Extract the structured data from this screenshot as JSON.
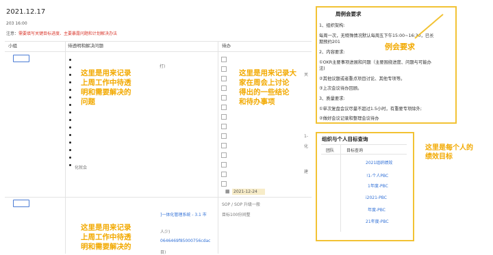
{
  "header": {
    "date": "2021.12.17",
    "time": "203 16:00",
    "note_prefix": "注意：",
    "note_red": "需要填写关键目标进度、主要暴露问题和计划解决办法"
  },
  "table": {
    "col_group": "小组",
    "col_issues": "待透明和解决问题",
    "col_todo": "待办"
  },
  "annotations": {
    "issues_1": "这里是用来记录\n上周工作中待透\n明和需要解决的\n问题",
    "todo": "这里是用来记录大\n家在周会上讨论\n得出的一些结论\n和待办事项",
    "issues_2": "这里是用来记录\n上周工作中待透\n明和需要解决的",
    "meeting_req": "例会要求",
    "goals": "这里是每个人的\n绩效目标"
  },
  "row1": {
    "faint_right": "打)",
    "todo_side": [
      "关",
      "1-",
      "化",
      "建"
    ],
    "date_tag": "2021-12-24",
    "mid_text": "化就会"
  },
  "row2": {
    "system_text": "]一体化管理系统 - 3.1 市",
    "sop": "SOP / SOP 升级一般",
    "target": "目标100份间整",
    "person": "人少)",
    "hash": "0646469f85000756cdac",
    "tail": "目)"
  },
  "meeting": {
    "title": "周例会要求",
    "lines": [
      "1、组织架构:",
      "每周一次，无特殊情况默认每周五下午15:00~16:30，已长",
      "期预约201",
      "2、内容要求:",
      "①OKR主要事项进展和问题（主要围绕进度、问题与可能办",
      "法)",
      "②其他议题或者重点项目讨论、其他专项等。",
      "③上次会议待办回顾。",
      "3、质量要求:",
      "①单次复盘会议尽量不超过1.5小时，有重要专项除外;",
      "②做好会议记录和整理会议待办"
    ]
  },
  "goals": {
    "title": "组织与个人目标查询",
    "th_1": "团队",
    "th_2": "目标查询",
    "links": [
      "2021组织绩效",
      "!1-个人PBC",
      "1年度-PBC",
      "i2021-PBC",
      "年度-PBC",
      "21年度-PBC"
    ]
  }
}
